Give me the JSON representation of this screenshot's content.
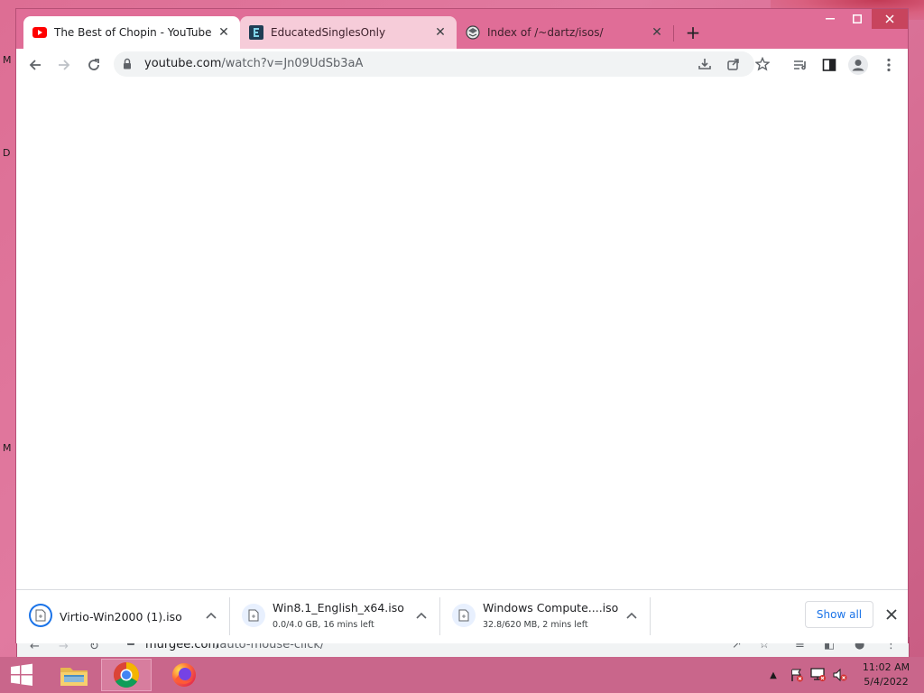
{
  "desktop": {
    "edge_letters": [
      "M",
      "D",
      "M"
    ]
  },
  "tabs": [
    {
      "title": "The Best of Chopin - YouTube",
      "icon": "youtube-icon",
      "active": true
    },
    {
      "title": "EducatedSinglesOnly",
      "icon": "educated-singles-icon",
      "active": false
    },
    {
      "title": "Index of /~dartz/isos/",
      "icon": "globe-icon",
      "active": false
    }
  ],
  "toolbar": {
    "url_host": "youtube.com",
    "url_rest": "/watch?v=Jn09UdSb3aA"
  },
  "downloads": [
    {
      "name": "Virtio-Win2000 (1).iso",
      "status": ""
    },
    {
      "name": "Win8.1_English_x64.iso",
      "status": "0.0/4.0 GB, 16 mins left"
    },
    {
      "name": "Windows Compute....iso",
      "status": "32.8/620 MB, 2 mins left"
    }
  ],
  "download_bar": {
    "show_all_label": "Show all"
  },
  "background_window": {
    "url_host": "murgee.com",
    "url_rest": "/auto-mouse-click/"
  },
  "clock": {
    "time": "11:02 AM",
    "date": "5/4/2022"
  },
  "colors": {
    "accent": "#1a73e8",
    "titlebar": "#e06d97",
    "taskbar": "#c9668b"
  }
}
